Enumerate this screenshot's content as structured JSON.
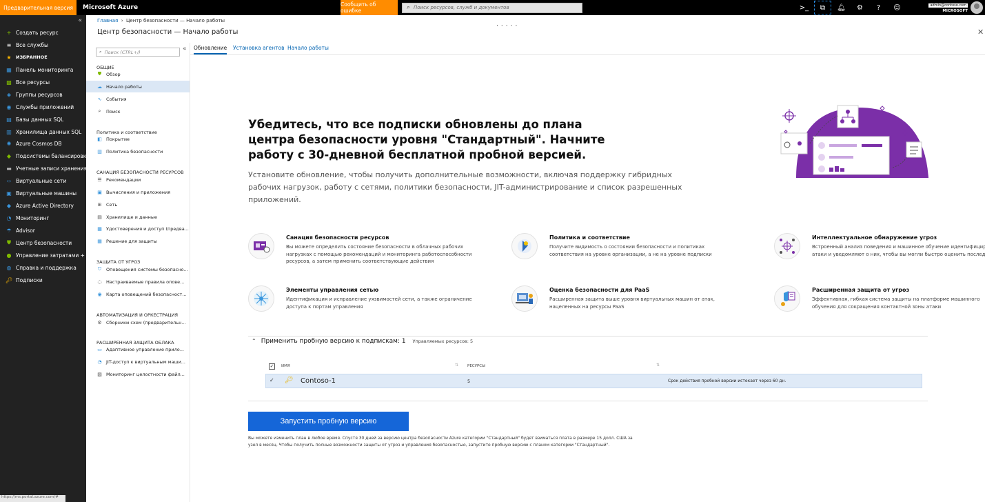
{
  "topbar": {
    "preview_label": "Предварительная версия",
    "brand": "Microsoft Azure",
    "report_bug": "Сообщить об ошибке",
    "search_placeholder": "Поиск ресурсов, служб и документов",
    "account_email": "admin@contoso.com",
    "account_org": "MICROSOFT"
  },
  "leftnav": {
    "items": [
      {
        "label": "Создать ресурс",
        "icon": "plus-icon",
        "color": "#7fba00"
      },
      {
        "label": "Все службы",
        "icon": "list-icon",
        "color": "#ffffff"
      },
      {
        "label": "ИЗБРАННОЕ",
        "icon": "star-icon",
        "color": "#ffb900"
      },
      {
        "label": "Панель мониторинга",
        "icon": "dashboard-icon",
        "color": "#3a96dd"
      },
      {
        "label": "Все ресурсы",
        "icon": "grid-icon",
        "color": "#7fba00"
      },
      {
        "label": "Группы ресурсов",
        "icon": "cube-icon",
        "color": "#3a96dd"
      },
      {
        "label": "Службы приложений",
        "icon": "globe-icon",
        "color": "#3a96dd"
      },
      {
        "label": "Базы данных SQL",
        "icon": "sql-icon",
        "color": "#3a96dd"
      },
      {
        "label": "Хранилища данных SQL",
        "icon": "warehouse-icon",
        "color": "#3a96dd"
      },
      {
        "label": "Azure Cosmos DB",
        "icon": "cosmos-icon",
        "color": "#3a96dd"
      },
      {
        "label": "Подсистемы балансировки ...",
        "icon": "balancer-icon",
        "color": "#7fba00"
      },
      {
        "label": "Учетные записи хранения",
        "icon": "storage-icon",
        "color": "#b4b4b4"
      },
      {
        "label": "Виртуальные сети",
        "icon": "network-icon",
        "color": "#3a96dd"
      },
      {
        "label": "Виртуальные машины",
        "icon": "vm-icon",
        "color": "#3a96dd"
      },
      {
        "label": "Azure Active Directory",
        "icon": "aad-icon",
        "color": "#3a96dd"
      },
      {
        "label": "Мониторинг",
        "icon": "monitor-icon",
        "color": "#3a96dd"
      },
      {
        "label": "Advisor",
        "icon": "advisor-icon",
        "color": "#3a96dd"
      },
      {
        "label": "Центр безопасности",
        "icon": "shield-icon",
        "color": "#7fba00"
      },
      {
        "label": "Управление затратами + в...",
        "icon": "cost-icon",
        "color": "#7fba00"
      },
      {
        "label": "Справка и поддержка",
        "icon": "help-icon",
        "color": "#3a96dd"
      },
      {
        "label": "Подписки",
        "icon": "key-icon",
        "color": "#ffb900"
      }
    ]
  },
  "breadcrumb": {
    "home": "Главная",
    "current": "Центр безопасности — Начало работы"
  },
  "blade": {
    "title": "Центр безопасности — Начало работы"
  },
  "menu": {
    "search_placeholder": "Поиск (CTRL+/)",
    "sections": [
      {
        "title": "ОБЩИЕ",
        "items": [
          "Обзор",
          "Начало работы",
          "События",
          "Поиск"
        ]
      },
      {
        "title": "Политика и соответствие",
        "items": [
          "Покрытие",
          "Политика безопасности"
        ]
      },
      {
        "title": "САНАЦИЯ БЕЗОПАСНОСТИ РЕСУРСОВ",
        "items": [
          "Рекомендации",
          "Вычисления и приложения",
          "Сеть",
          "Хранилище и данные",
          "Удостоверения и доступ (предва...",
          "Решение для защиты"
        ]
      },
      {
        "title": "ЗАЩИТА ОТ УГРОЗ",
        "items": [
          "Оповещения системы безопасно...",
          "Настраиваемые правила опове...",
          "Карта оповещений безопасност..."
        ]
      },
      {
        "title": "АВТОМАТИЗАЦИЯ И ОРКЕСТРАЦИЯ",
        "items": [
          "Сборники схем (предварительн..."
        ]
      },
      {
        "title": "РАСШИРЕННАЯ ЗАЩИТА ОБЛАКА",
        "items": [
          "Адаптивное управление прило...",
          "JIT-доступ к виртуальным маши...",
          "Мониторинг целостности файл..."
        ]
      }
    ]
  },
  "tabs": [
    "Обновление",
    "Установка агентов",
    "Начало работы"
  ],
  "hero": {
    "title": "Убедитесь, что все подписки обновлены до плана центра безопасности уровня \"Стандартный\". Начните работу с 30-дневной бесплатной пробной версией.",
    "subtitle": "Установите обновление, чтобы получить дополнительные возможности, включая поддержку гибридных рабочих нагрузок, работу с сетями, политики безопасности, JIT-администрирование и список разрешенных приложений."
  },
  "features": [
    {
      "title": "Санация безопасности ресурсов",
      "desc": "Вы можете определить состояние безопасности в облачных рабочих нагрузках с помощью рекомендаций и мониторинга работоспособности ресурсов, а затем применить соответствующие действия",
      "icon": "remediation-icon"
    },
    {
      "title": "Политика и соответствие",
      "desc": "Получите видимость о состоянии безопасности и политиках соответствия на уровне организации, а не на уровне подписки",
      "icon": "policy-icon"
    },
    {
      "title": "Интеллектуальное обнаружение угроз",
      "desc": "Встроенный анализ поведения и машинное обучение идентифицируют атаки и уведомляют о них, чтобы вы могли быстро оценить последствия",
      "icon": "threat-detection-icon"
    },
    {
      "title": "Элементы управления сетью",
      "desc": "Идентификация и исправление уязвимостей сети, а также ограничение доступа к портам управления",
      "icon": "network-control-icon"
    },
    {
      "title": "Оценка безопасности для PaaS",
      "desc": "Расширенная защита выше уровня виртуальных машин от атак, нацеленных на ресурсы PaaS",
      "icon": "paas-icon"
    },
    {
      "title": "Расширенная защита от угроз",
      "desc": "Эффективная, гибкая система защиты на платформе машинного обучения для сокращения контактной зоны атаки",
      "icon": "advanced-protection-icon"
    }
  ],
  "subscriptions": {
    "apply_label": "Применить пробную версию к подпискам: 1",
    "managed_label": "Управляемых ресурсов: 5",
    "columns": [
      "ИМЯ",
      "РЕСУРСЫ"
    ],
    "rows": [
      {
        "name": "Contoso-1",
        "resources": "5",
        "trial": "Срок действия пробной версии истекает через 60 дн."
      }
    ]
  },
  "start_button": "Запустить пробную версию",
  "note": "Вы можете изменить план в любое время. Спустя 30 дней за версию центра безопасности Azure категории \"Стандартный\" будет взиматься плата в размере 15 долл. США за узел в месяц. Чтобы получить полные возможности защиты от угроз и управления безопасностью, запустите пробную версию с планом категории \"Стандартный\".",
  "status_url": "https://ms.portal.azure.com/#",
  "colors": {
    "accent": "#0063b1",
    "button": "#1566d8",
    "purple": "#7b2fa8",
    "orange": "#ff8c00"
  }
}
